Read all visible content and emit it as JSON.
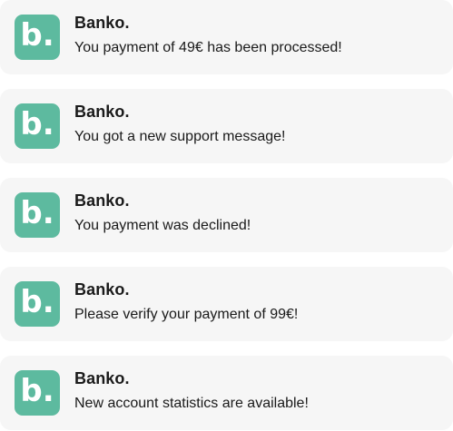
{
  "notifications": [
    {
      "app_name": "Banko.",
      "logo_letter": "b",
      "logo_dot": ".",
      "message": "You payment of 49€ has been processed!"
    },
    {
      "app_name": "Banko.",
      "logo_letter": "b",
      "logo_dot": ".",
      "message": "You got a new support message!"
    },
    {
      "app_name": "Banko.",
      "logo_letter": "b",
      "logo_dot": ".",
      "message": "You payment was declined!"
    },
    {
      "app_name": "Banko.",
      "logo_letter": "b",
      "logo_dot": ".",
      "message": "Please verify your payment of 99€!"
    },
    {
      "app_name": "Banko.",
      "logo_letter": "b",
      "logo_dot": ".",
      "message": "New account statistics are available!"
    }
  ],
  "colors": {
    "brand": "#5dba9f",
    "card_background": "#f6f6f6",
    "text": "#1a1a1a"
  }
}
